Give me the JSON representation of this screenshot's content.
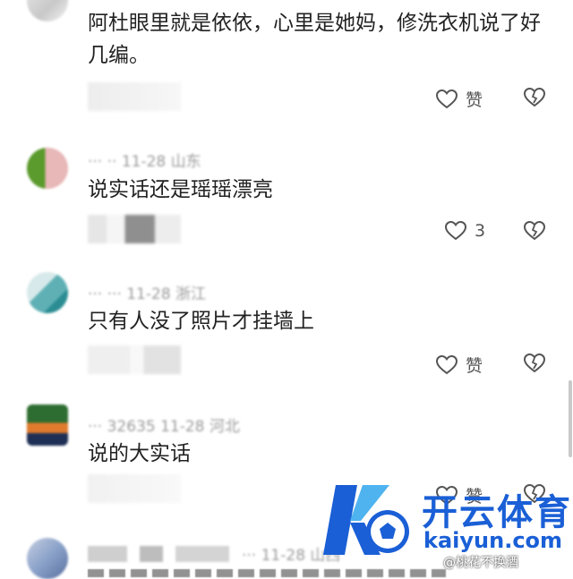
{
  "comments": [
    {
      "text": "阿杜眼里就是依依，心里是她妈，修洗衣机说了好几编。",
      "like_label": "赞",
      "avatar_colors": [
        "#e9e9e9",
        "#c8c8c8",
        "#f4f4f4"
      ]
    },
    {
      "meta": "··· ·· 11-28 山东",
      "text": "说实话还是瑶瑶漂亮",
      "like_label": "3",
      "avatar_colors": [
        "#5b9a2d",
        "#e8b7b7",
        "#f2d7d2"
      ]
    },
    {
      "meta": "··· ··· 11-28 浙江",
      "text": "只有人没了照片才挂墙上",
      "like_label": "赞",
      "avatar_colors": [
        "#5fb0b5",
        "#d7e9ea",
        "#2b8d93"
      ]
    },
    {
      "meta": "··· 32635 11-28 河北",
      "text": "说的大实话",
      "like_label": "赞",
      "avatar_colors": [
        "#2e6d31",
        "#e07a2d",
        "#1e2f55"
      ]
    },
    {
      "meta": "··· 11-28 山西",
      "text": "",
      "like_label": "",
      "avatar_colors": [
        "#8aa2c9",
        "#5a6fa0",
        "#c5cde0"
      ]
    }
  ],
  "watermark": {
    "brand_cn": "开云体育",
    "brand_en": "kaiyun.com",
    "credit": "@桃花不换酒",
    "colors": {
      "blue": "#1a5fd6",
      "light_blue": "#4fb3f0"
    }
  }
}
